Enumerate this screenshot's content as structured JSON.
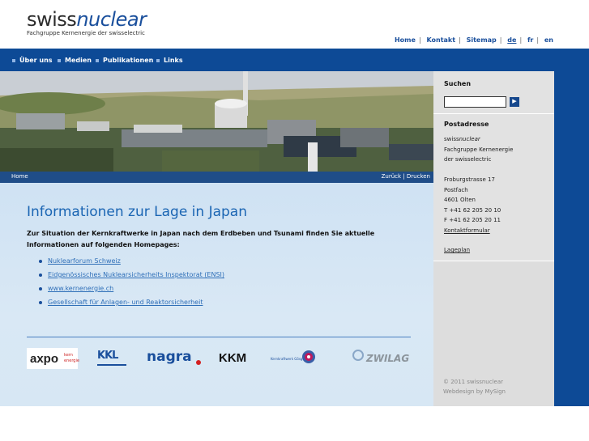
{
  "brand": {
    "name_plain": "swiss",
    "name_accent": "nuclear",
    "tagline": "Fachgruppe Kernenergie der swisselectric"
  },
  "metanav": {
    "home": "Home",
    "kontakt": "Kontakt",
    "sitemap": "Sitemap",
    "de": "de",
    "fr": "fr",
    "en": "en"
  },
  "mainnav": [
    "Über uns",
    "Medien",
    "Publikationen",
    "Links"
  ],
  "breadcrumb": {
    "home": "Home",
    "actions": "Zurück | Drucken"
  },
  "content": {
    "title": "Informationen zur Lage in Japan",
    "intro": "Zur Situation der Kernkraftwerke in Japan nach dem Erdbeben und Tsunami finden Sie aktuelle Informationen auf folgenden Homepages:",
    "links": [
      "Nuklearforum Schweiz",
      "Eidgenössisches Nuklearsicherheits Inspektorat (ENSI)",
      "www.kernenergie.ch",
      "Gesellschaft für Anlagen- und Reaktorsicherheit"
    ]
  },
  "partner_logos": {
    "axpo": {
      "text": "axpo",
      "sub1": "kern",
      "sub2": "energie"
    },
    "kkl": {
      "text": "KKL"
    },
    "nagra": {
      "text": "nagra"
    },
    "kkm": {
      "text": "KKM"
    },
    "goesgen": {
      "text": "Kernkraftwerk Gösgen"
    },
    "zwilag": {
      "text": "ZWILAG"
    }
  },
  "sidebar": {
    "search_title": "Suchen",
    "search_value": "",
    "search_button": "▶",
    "address_title": "Postadresse",
    "brand_plain": "swiss",
    "brand_accent": "nuclear",
    "org_line1": "Fachgruppe Kernenergie",
    "org_line2": "der swisselectric",
    "street": "Froburgstrasse 17",
    "box": "Postfach",
    "city": "4601 Olten",
    "phone": "T +41 62 205 20 10",
    "fax": "F +41 62 205 20 11",
    "contact_form": "Kontaktformular",
    "map": "Lageplan",
    "copyright": "© 2011 swissnuclear",
    "webdesign": "Webdesign by MySign"
  },
  "colors": {
    "primary": "#0d4a96",
    "link": "#2f6fb8",
    "title": "#1a65b3",
    "content_bg": "#d7e7f4",
    "sidebar_bg": "#e2e2e2"
  }
}
